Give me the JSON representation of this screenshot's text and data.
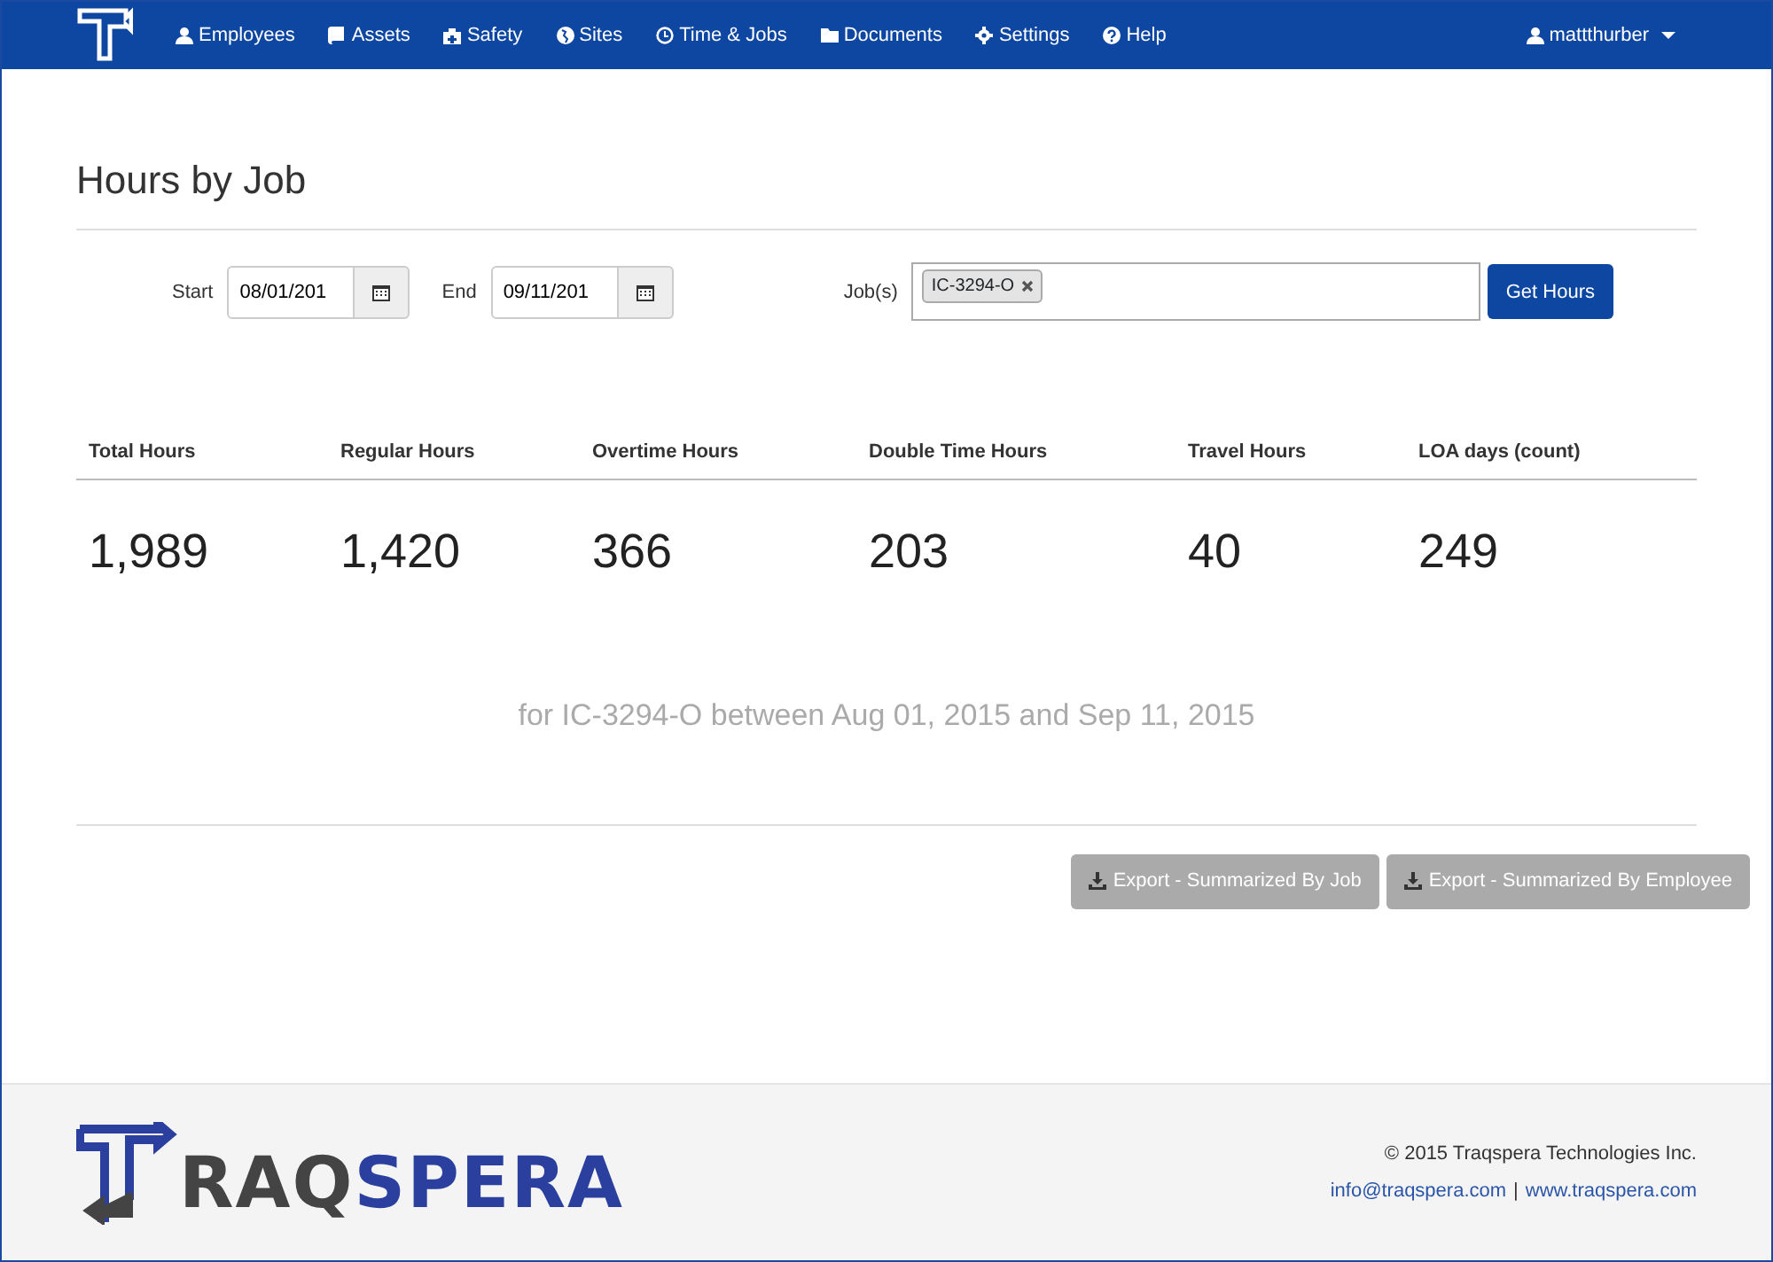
{
  "nav": {
    "items": [
      {
        "label": "Employees"
      },
      {
        "label": "Assets"
      },
      {
        "label": "Safety"
      },
      {
        "label": "Sites"
      },
      {
        "label": "Time & Jobs"
      },
      {
        "label": "Documents"
      },
      {
        "label": "Settings"
      },
      {
        "label": "Help"
      }
    ],
    "user": "mattthurber"
  },
  "title": "Hours by Job",
  "filters": {
    "start_label": "Start",
    "start": "08/01/201",
    "end_label": "End",
    "end": "09/11/201",
    "jobs_label": "Job(s)",
    "jobs": [
      "IC-3294-O"
    ],
    "button": "Get Hours"
  },
  "stats": [
    {
      "label": "Total Hours",
      "value": "1,989"
    },
    {
      "label": "Regular Hours",
      "value": "1,420"
    },
    {
      "label": "Overtime Hours",
      "value": "366"
    },
    {
      "label": "Double Time Hours",
      "value": "203"
    },
    {
      "label": "Travel Hours",
      "value": "40"
    },
    {
      "label": "LOA days (count)",
      "value": "249"
    }
  ],
  "summary": "for IC-3294-O between Aug 01, 2015 and Sep 11, 2015",
  "exports": [
    "Export - Summarized By Job",
    "Export - Summarized By Employee"
  ],
  "footer": {
    "logo_dark": "RAQ",
    "logo_blue": "SPERA",
    "copyright": "© 2015 Traqspera Technologies Inc.",
    "email": "info@traqspera.com",
    "separator": "|",
    "website": "www.traqspera.com"
  }
}
